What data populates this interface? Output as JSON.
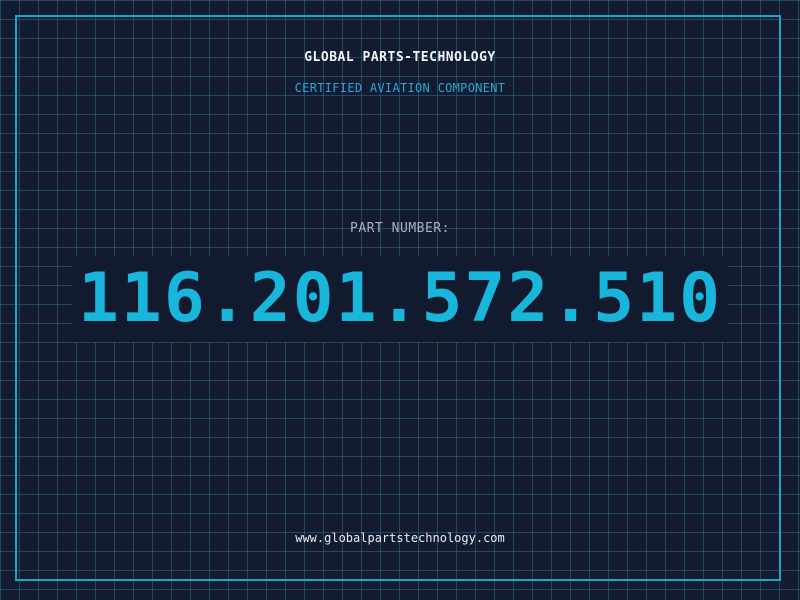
{
  "header": {
    "company_name": "GLOBAL PARTS-TECHNOLOGY",
    "tagline": "CERTIFIED AVIATION COMPONENT"
  },
  "part": {
    "label": "PART NUMBER:",
    "number": "116.201.572.510"
  },
  "footer": {
    "website": "www.globalpartstechnology.com"
  },
  "colors": {
    "background": "#121b30",
    "grid": "#2a6e8c",
    "accent": "#19b6dc",
    "frame": "#1fa3c8",
    "text_light": "#f2f4f6",
    "text_muted": "#a8b3bf"
  }
}
